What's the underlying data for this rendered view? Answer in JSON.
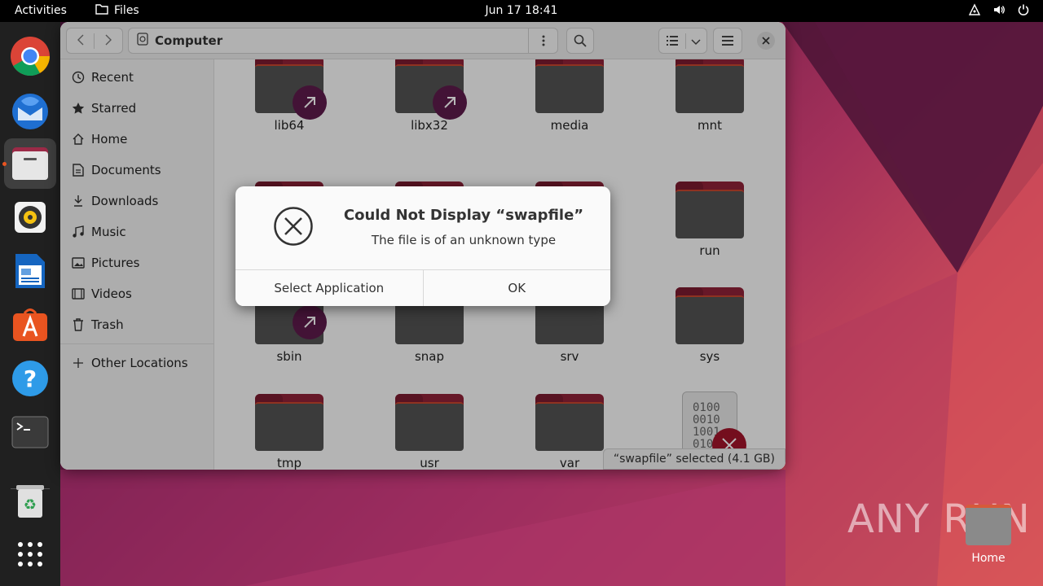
{
  "topbar": {
    "activities": "Activities",
    "app_name": "Files",
    "clock": "Jun 17  18:41"
  },
  "dock": {
    "items": [
      {
        "name": "chrome-icon"
      },
      {
        "name": "thunderbird-icon"
      },
      {
        "name": "files-icon",
        "active": true
      },
      {
        "name": "rhythmbox-icon"
      },
      {
        "name": "libreoffice-writer-icon"
      },
      {
        "name": "app-center-icon"
      },
      {
        "name": "help-icon"
      },
      {
        "name": "terminal-icon"
      },
      {
        "name": "trash-icon"
      },
      {
        "name": "show-apps-icon"
      }
    ]
  },
  "window": {
    "path_label": "Computer",
    "sidebar": {
      "items": [
        {
          "label": "Recent",
          "icon": "clock-icon"
        },
        {
          "label": "Starred",
          "icon": "star-icon"
        },
        {
          "label": "Home",
          "icon": "home-icon"
        },
        {
          "label": "Documents",
          "icon": "document-icon"
        },
        {
          "label": "Downloads",
          "icon": "download-icon"
        },
        {
          "label": "Music",
          "icon": "music-icon"
        },
        {
          "label": "Pictures",
          "icon": "picture-icon"
        },
        {
          "label": "Videos",
          "icon": "video-icon"
        },
        {
          "label": "Trash",
          "icon": "trash-icon"
        }
      ],
      "other_locations": "Other Locations"
    },
    "files": [
      {
        "name": "lib64",
        "link": true
      },
      {
        "name": "libx32",
        "link": true
      },
      {
        "name": "media"
      },
      {
        "name": "mnt"
      },
      {
        "name": ""
      },
      {
        "name": ""
      },
      {
        "name": ""
      },
      {
        "name": "run"
      },
      {
        "name": "sbin",
        "link": true
      },
      {
        "name": "snap"
      },
      {
        "name": "srv"
      },
      {
        "name": "sys"
      },
      {
        "name": "tmp"
      },
      {
        "name": "usr"
      },
      {
        "name": "var"
      },
      {
        "name": "swapfile",
        "selected": true
      }
    ],
    "status": "“swapfile” selected  (4.1 GB)"
  },
  "dialog": {
    "title": "Could Not Display “swapfile”",
    "message": "The file is of an unknown type",
    "select_app": "Select Application",
    "ok": "OK"
  },
  "desktop": {
    "home_label": "Home",
    "watermark": "ANY RUN"
  },
  "colors": {
    "accent": "#e95420",
    "folder_red": "#8f2238",
    "folder_body": "#525252",
    "link_badge": "#5e1b4b",
    "error_red": "#a1142a"
  }
}
